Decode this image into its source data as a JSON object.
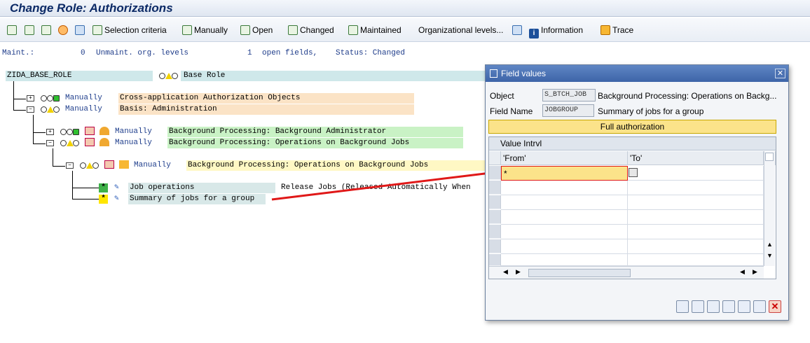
{
  "window": {
    "title": "Change Role: Authorizations"
  },
  "toolbar": {
    "selection_criteria": "Selection criteria",
    "manually": "Manually",
    "open": "Open",
    "changed": "Changed",
    "maintained": "Maintained",
    "org_levels": "Organizational levels...",
    "information": "Information",
    "trace": "Trace"
  },
  "status": {
    "maint_label": "Maint.:",
    "maint_count": "0",
    "unmaint_label": "Unmaint. org. levels",
    "open_count": "1",
    "open_label": "open fields,",
    "status_label": "Status: Changed"
  },
  "tree": {
    "root": {
      "name": "ZIDA_BASE_ROLE",
      "desc": "Base Role"
    },
    "n1": {
      "type": "Manually",
      "desc": "Cross-application Authorization Objects"
    },
    "n2": {
      "type": "Manually",
      "desc": "Basis: Administration"
    },
    "n3": {
      "type": "Manually",
      "desc": "Background Processing: Background Administrator"
    },
    "n4": {
      "type": "Manually",
      "desc": "Background Processing: Operations on Background Jobs"
    },
    "n5": {
      "type": "Manually",
      "desc": "Background Processing: Operations on Background Jobs"
    },
    "field1": {
      "marker": "*",
      "name": "Job operations",
      "value": "Release Jobs (Released Automatically When"
    },
    "field2": {
      "marker": "*",
      "name": "Summary of jobs for a group"
    }
  },
  "dialog": {
    "title": "Field values",
    "object_label": "Object",
    "object_value": "S_BTCH_JOB",
    "object_desc": "Background Processing: Operations on Backg...",
    "field_label": "Field Name",
    "field_value": "JOBGROUP",
    "field_desc": "Summary of jobs for a group",
    "full_auth": "Full authorization",
    "grid_title": "Value Intrvl",
    "col_from": "'From'",
    "col_to": "'To'",
    "row1_from": "*"
  },
  "colors": {
    "arrow": "#e01818",
    "title": "#0c2a66",
    "highlight_yellow": "#fbe38a"
  }
}
